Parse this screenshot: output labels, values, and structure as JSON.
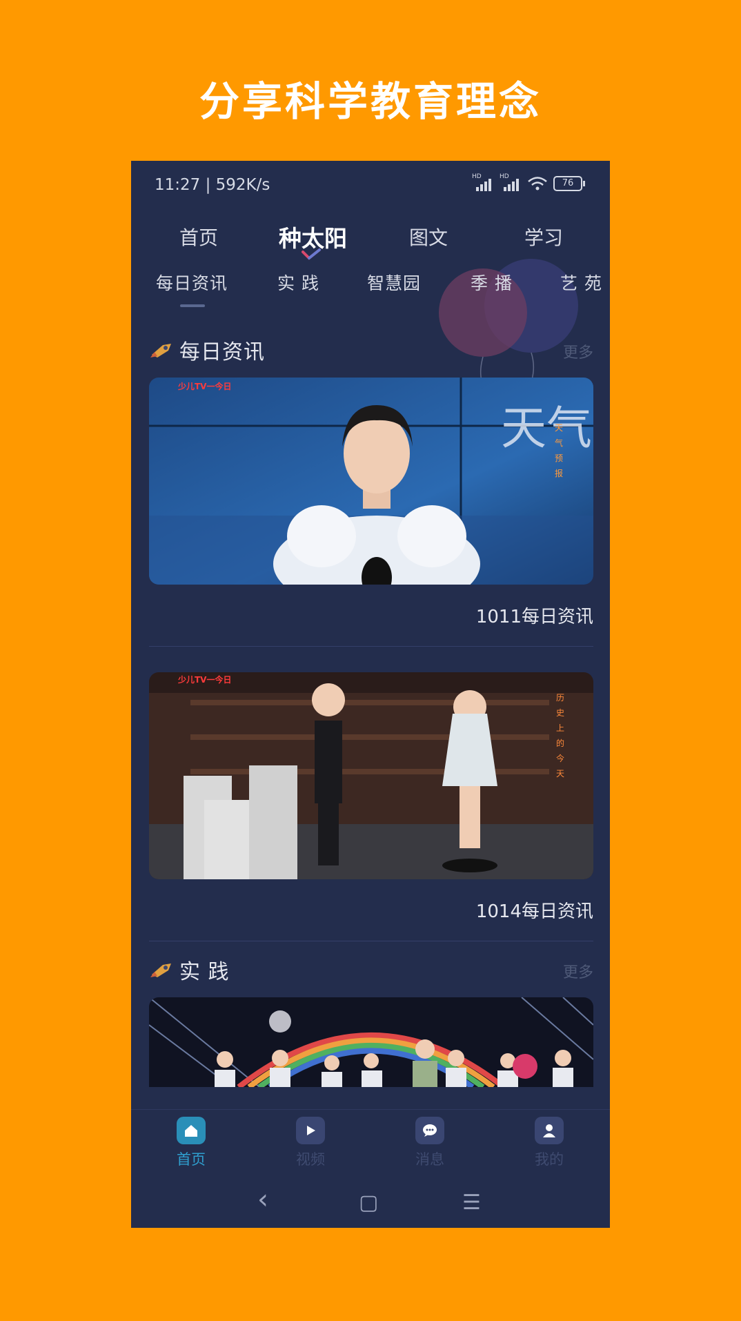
{
  "promo": {
    "headline": "分享科学教育理念"
  },
  "status_bar": {
    "time": "11:27 | 592K/s",
    "battery": "76",
    "signal_label_1": "HD",
    "signal_label_2": "HD"
  },
  "top_tabs": [
    {
      "label": "首页"
    },
    {
      "label": "种太阳",
      "active": true
    },
    {
      "label": "图文"
    },
    {
      "label": "学习"
    }
  ],
  "sub_tabs": [
    {
      "label": "每日资讯",
      "active": true
    },
    {
      "label": "实 践"
    },
    {
      "label": "智慧园"
    },
    {
      "label": "季 播"
    },
    {
      "label": "艺 苑"
    }
  ],
  "sections": [
    {
      "title": "每日资讯",
      "more": "更多",
      "cards": [
        {
          "caption": "1011每日资讯",
          "image_alt": "girl presenting weather forecast",
          "logo_text": "少儿TV一今日",
          "overlay_text": "天气",
          "side_text": [
            "天",
            "气",
            "预",
            "报"
          ]
        },
        {
          "caption": "1014每日资讯",
          "image_alt": "two children in library studio",
          "logo_text": "少儿TV一今日",
          "side_text": [
            "历",
            "史",
            "上",
            "的",
            "今",
            "天"
          ]
        }
      ]
    },
    {
      "title": "实 践",
      "more": "更多",
      "cards": [
        {
          "caption": "",
          "image_alt": "group of children on stage with rainbow"
        }
      ]
    }
  ],
  "bottom_nav": [
    {
      "label": "首页",
      "icon": "home-icon",
      "active": true
    },
    {
      "label": "视频",
      "icon": "play-icon"
    },
    {
      "label": "消息",
      "icon": "message-icon"
    },
    {
      "label": "我的",
      "icon": "user-icon"
    }
  ],
  "system_nav": {
    "back": "‹",
    "home": "▢",
    "menu": "☰"
  },
  "colors": {
    "background": "#ff9900",
    "app_bg": "#232d4d",
    "accent": "#2fa0d0"
  }
}
